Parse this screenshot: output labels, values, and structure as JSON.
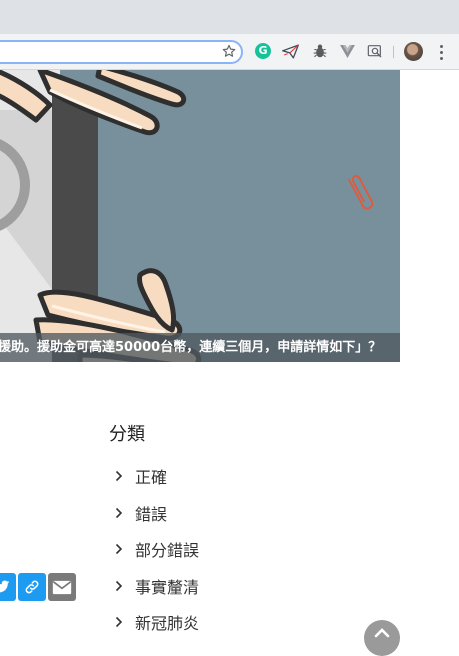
{
  "browser": {
    "extensions": [
      "grammarly-icon",
      "paper-plane-icon",
      "bug-icon",
      "vue-devtools-icon",
      "screenshot-lens-icon"
    ],
    "colors": {
      "tabstrip": "#dee1e6",
      "toolbar": "#f1f3f4",
      "omnibox_focus": "#8ab4f8"
    }
  },
  "hero": {
    "caption": "援助。援助金可高達50000台幣，連續三個月，申請詳情如下」？",
    "colors": {
      "background": "#78909c",
      "caption_bg": "#505860"
    }
  },
  "categories": {
    "title": "分類",
    "items": [
      {
        "label": "正確"
      },
      {
        "label": "錯誤"
      },
      {
        "label": "部分錯誤"
      },
      {
        "label": "事實釐清"
      },
      {
        "label": "新冠肺炎"
      }
    ]
  },
  "share": {
    "buttons": [
      "twitter-icon",
      "link-icon",
      "mail-icon"
    ],
    "colors": {
      "twitter": "#1d9bf0",
      "link": "#1d9bf0",
      "mail": "#7a7a7a"
    }
  }
}
